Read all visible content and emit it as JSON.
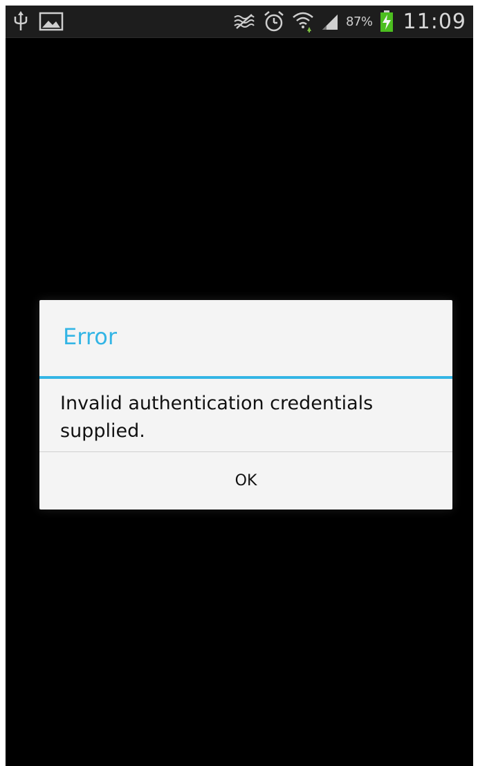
{
  "status_bar": {
    "left_icons": [
      "usb-icon",
      "image-notification-icon"
    ],
    "right_icons": [
      "mute-icon",
      "alarm-icon",
      "wifi-icon",
      "signal-icon",
      "battery-charging-icon"
    ],
    "battery_percent": "87%",
    "time": "11:09"
  },
  "dialog": {
    "title": "Error",
    "message": "Invalid authentication credentials supplied.",
    "ok_label": "OK",
    "accent_color": "#33b5e5"
  }
}
